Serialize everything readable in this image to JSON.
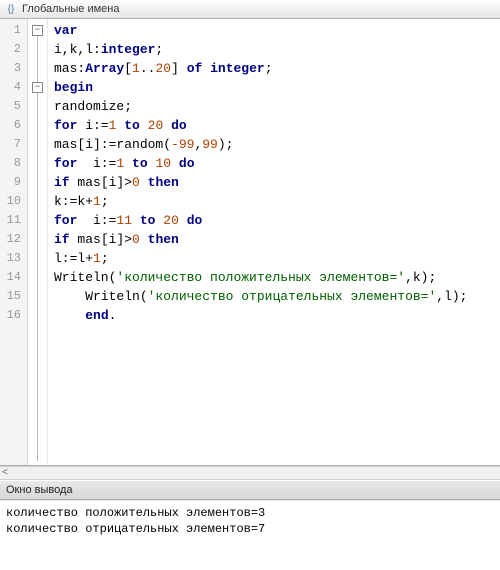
{
  "header": {
    "icon_name": "braces-icon",
    "title": "Глобальные имена"
  },
  "code": {
    "lines": [
      {
        "n": 1,
        "fold": "box",
        "tokens": [
          [
            "kw",
            "var"
          ]
        ]
      },
      {
        "n": 2,
        "tokens": [
          [
            "",
            ""
          ],
          [
            "",
            "i,k,l:"
          ],
          [
            "kw",
            "integer"
          ],
          [
            "",
            ";"
          ]
        ]
      },
      {
        "n": 3,
        "tokens": [
          [
            "",
            ""
          ],
          [
            "",
            "mas:"
          ],
          [
            "kw",
            "Array"
          ],
          [
            "",
            "["
          ],
          [
            "num",
            "1"
          ],
          [
            "",
            ".."
          ],
          [
            "num",
            "20"
          ],
          [
            "",
            "] "
          ],
          [
            "kw",
            "of"
          ],
          [
            "",
            ""
          ],
          [
            "kw",
            " integer"
          ],
          [
            "",
            ";"
          ]
        ]
      },
      {
        "n": 4,
        "fold": "box",
        "tokens": [
          [
            "kw",
            "begin"
          ]
        ]
      },
      {
        "n": 5,
        "tokens": [
          [
            "",
            ""
          ],
          [
            "",
            "randomize;"
          ]
        ]
      },
      {
        "n": 6,
        "tokens": [
          [
            "",
            ""
          ],
          [
            "kw",
            "for"
          ],
          [
            "",
            ""
          ],
          [
            "",
            ""
          ],
          [
            "",
            " i:="
          ],
          [
            "num",
            "1"
          ],
          [
            "",
            ""
          ],
          [
            "",
            " "
          ],
          [
            "kw",
            "to"
          ],
          [
            "",
            ""
          ],
          [
            "",
            " "
          ],
          [
            "num",
            "20"
          ],
          [
            "",
            ""
          ],
          [
            "",
            " "
          ],
          [
            "kw",
            "do"
          ]
        ]
      },
      {
        "n": 7,
        "tokens": [
          [
            "",
            ""
          ],
          [
            "",
            "mas[i]:=random("
          ],
          [
            "num",
            "-99"
          ],
          [
            "",
            ","
          ],
          [
            "num",
            "99"
          ],
          [
            "",
            ");"
          ]
        ]
      },
      {
        "n": 8,
        "tokens": [
          [
            "",
            ""
          ],
          [
            "kw",
            "for"
          ],
          [
            "",
            "  i:="
          ],
          [
            "num",
            "1"
          ],
          [
            "",
            ""
          ],
          [
            "",
            " "
          ],
          [
            "kw",
            "to"
          ],
          [
            "",
            ""
          ],
          [
            "",
            " "
          ],
          [
            "num",
            "10"
          ],
          [
            "",
            ""
          ],
          [
            "",
            " "
          ],
          [
            "kw",
            "do"
          ]
        ]
      },
      {
        "n": 9,
        "tokens": [
          [
            "",
            ""
          ],
          [
            "kw",
            "if"
          ],
          [
            "",
            ""
          ],
          [
            "",
            " mas[i]>"
          ],
          [
            "num",
            "0"
          ],
          [
            "",
            ""
          ],
          [
            "",
            " "
          ],
          [
            "kw",
            "then"
          ]
        ]
      },
      {
        "n": 10,
        "tokens": [
          [
            "",
            ""
          ],
          [
            "",
            "k:=k+"
          ],
          [
            "num",
            "1"
          ],
          [
            "",
            ";"
          ]
        ]
      },
      {
        "n": 11,
        "tokens": [
          [
            "",
            ""
          ],
          [
            "kw",
            "for"
          ],
          [
            "",
            "  i:="
          ],
          [
            "num",
            "11"
          ],
          [
            "",
            ""
          ],
          [
            "",
            " "
          ],
          [
            "kw",
            "to"
          ],
          [
            "",
            ""
          ],
          [
            "",
            " "
          ],
          [
            "num",
            "20"
          ],
          [
            "",
            ""
          ],
          [
            "",
            " "
          ],
          [
            "kw",
            "do"
          ]
        ]
      },
      {
        "n": 12,
        "tokens": [
          [
            "",
            ""
          ],
          [
            "kw",
            "if"
          ],
          [
            "",
            ""
          ],
          [
            "",
            " mas[i]>"
          ],
          [
            "num",
            "0"
          ],
          [
            "",
            ""
          ],
          [
            "",
            " "
          ],
          [
            "kw",
            "then"
          ]
        ]
      },
      {
        "n": 13,
        "tokens": [
          [
            "",
            ""
          ],
          [
            "",
            "l:=l+"
          ],
          [
            "num",
            "1"
          ],
          [
            "",
            ";"
          ]
        ]
      },
      {
        "n": 14,
        "tokens": [
          [
            "",
            ""
          ],
          [
            "",
            "Writeln("
          ],
          [
            "str",
            "'количество положительных элементов='"
          ],
          [
            "",
            ",k);"
          ]
        ]
      },
      {
        "n": 15,
        "tokens": [
          [
            "",
            ""
          ],
          [
            "",
            "    Writeln("
          ],
          [
            "str",
            "'количество отрицательных элементов='"
          ],
          [
            "",
            ",l);"
          ]
        ]
      },
      {
        "n": 16,
        "tokens": [
          [
            "",
            ""
          ],
          [
            "",
            "    "
          ],
          [
            "kw",
            "end"
          ],
          [
            "",
            "."
          ]
        ]
      }
    ]
  },
  "scroll": {
    "chevron": "<"
  },
  "output_panel": {
    "title": "Окно вывода",
    "lines": [
      "количество положительных элементов=3",
      "количество отрицательных элементов=7"
    ]
  }
}
